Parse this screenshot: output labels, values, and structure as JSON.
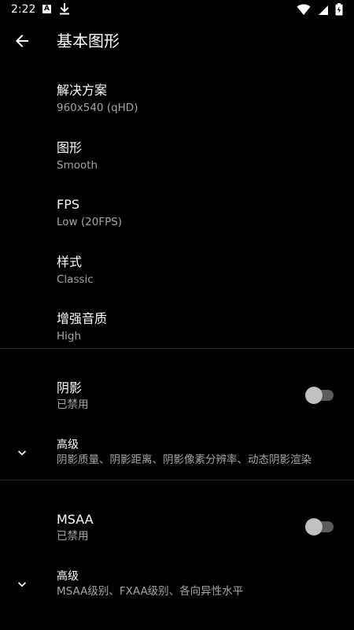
{
  "status": {
    "time": "2:22",
    "notification_letter": "A"
  },
  "header": {
    "title": "基本图形"
  },
  "prefs": [
    {
      "title": "解决方案",
      "summary": "960x540 (qHD)"
    },
    {
      "title": "图形",
      "summary": "Smooth"
    },
    {
      "title": "FPS",
      "summary": "Low (20FPS)"
    },
    {
      "title": "样式",
      "summary": "Classic"
    },
    {
      "title": "增强音质",
      "summary": "High"
    }
  ],
  "shadow": {
    "title": "阴影",
    "summary": "已禁用",
    "enabled": false,
    "advanced_title": "高级",
    "advanced_summary": "阴影质量、阴影距离、阴影像素分辨率、动态阴影渲染"
  },
  "msaa": {
    "title": "MSAA",
    "summary": "已禁用",
    "enabled": false,
    "advanced_title": "高级",
    "advanced_summary": "MSAA级别、FXAA级别、各向异性水平"
  },
  "icons": {
    "back": "arrow-back-icon",
    "expand": "chevron-down-icon",
    "wifi": "wifi-icon",
    "signal": "signal-icon",
    "battery": "battery-icon",
    "download": "download-icon"
  }
}
